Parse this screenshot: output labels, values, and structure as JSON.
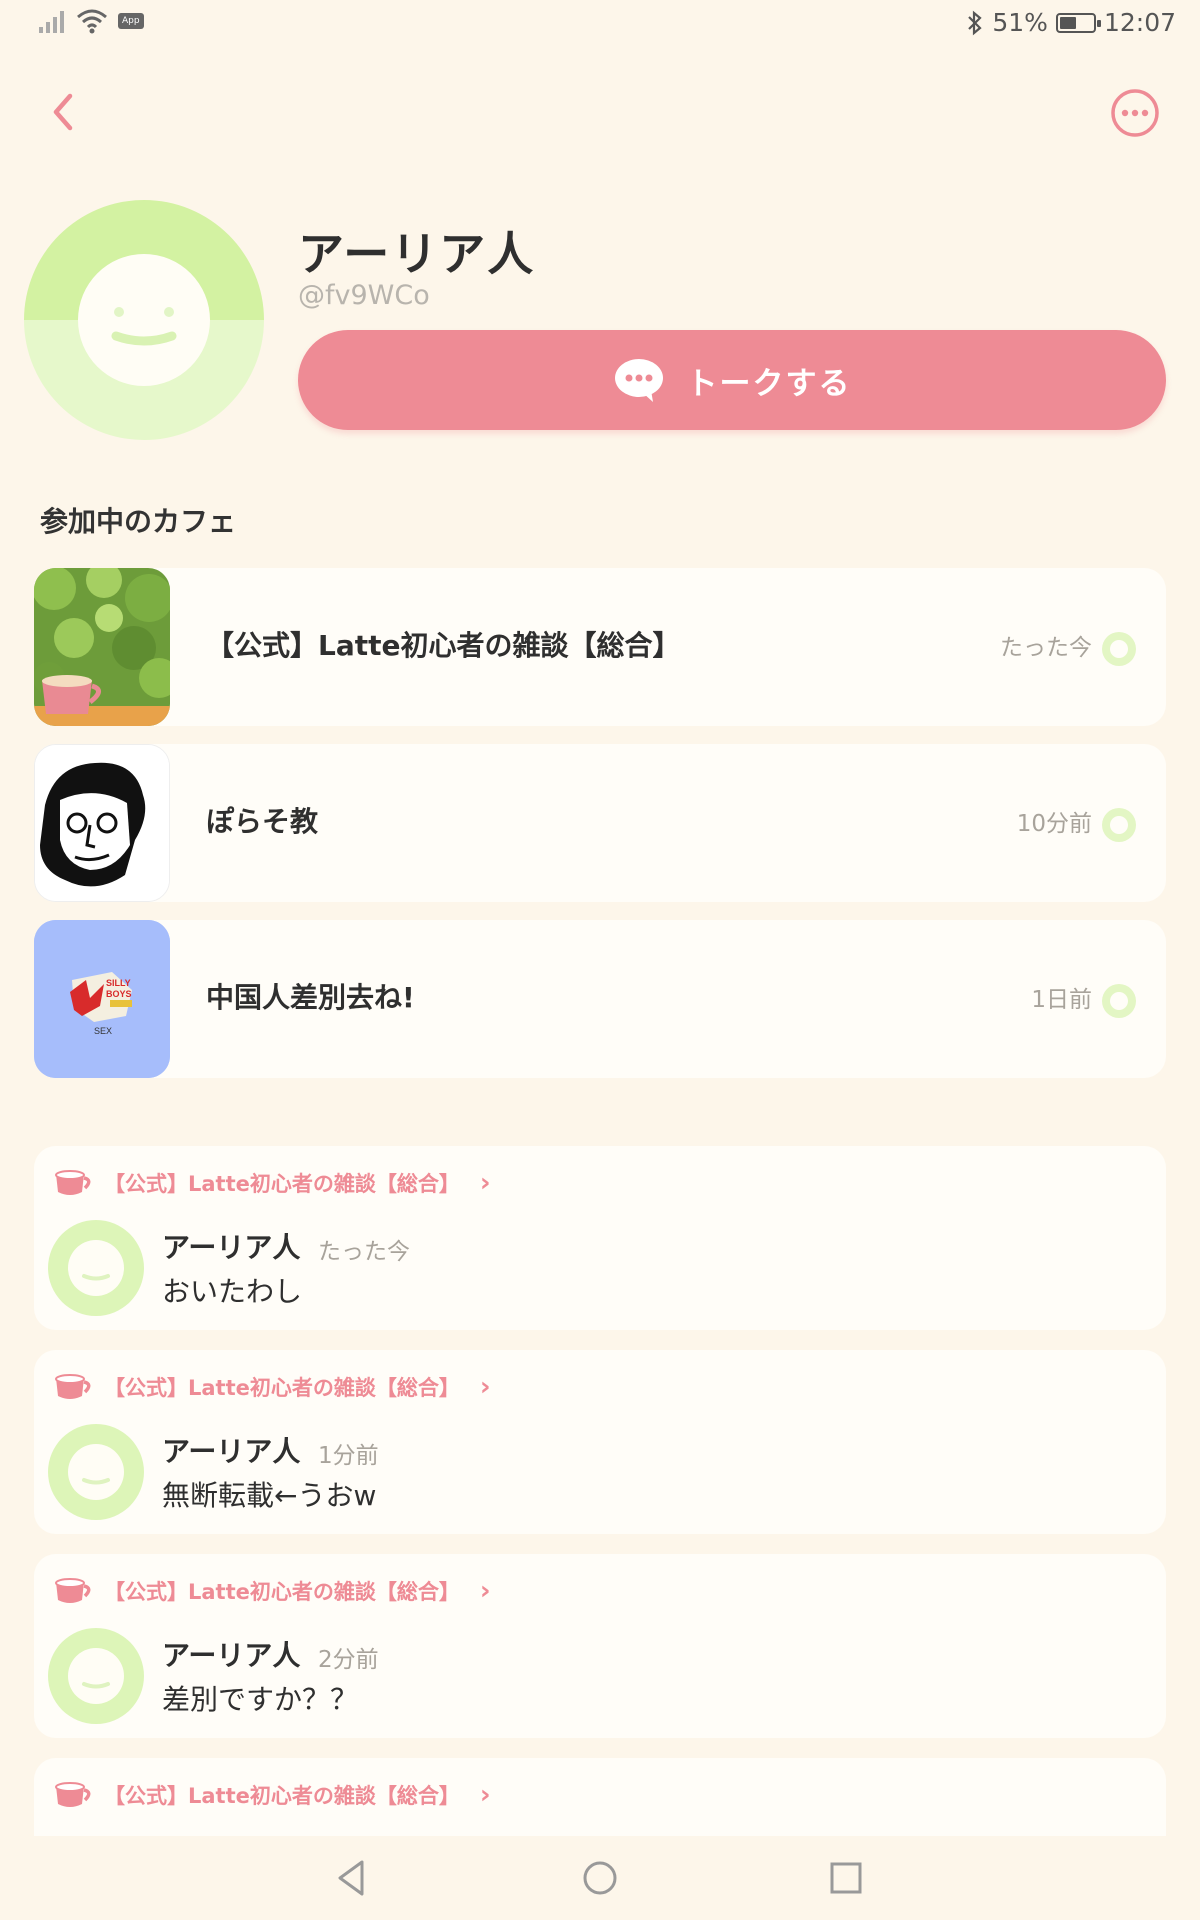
{
  "status_bar": {
    "app_badge": "App",
    "battery_pct": "51%",
    "battery_level": 0.51,
    "time": "12:07"
  },
  "header": {
    "back_icon": "chevron-left-icon",
    "more_icon": "more-dots-icon"
  },
  "profile": {
    "name": "アーリア人",
    "handle": "@fv9WCo",
    "talk_label": "トークする"
  },
  "cafes": {
    "title": "参加中のカフェ",
    "items": [
      {
        "name": "【公式】Latte初心者の雑談【総合】",
        "time": "たった今"
      },
      {
        "name": "ぽらそ教",
        "time": "10分前"
      },
      {
        "name": "中国人差別去ね!",
        "time": "1日前"
      }
    ]
  },
  "posts": [
    {
      "cafe": "【公式】Latte初心者の雑談【総合】",
      "author": "アーリア人",
      "time": "たった今",
      "text": "おいたわし"
    },
    {
      "cafe": "【公式】Latte初心者の雑談【総合】",
      "author": "アーリア人",
      "time": "1分前",
      "text": "無断転載←うおw"
    },
    {
      "cafe": "【公式】Latte初心者の雑談【総合】",
      "author": "アーリア人",
      "time": "2分前",
      "text": "差別ですか？？"
    },
    {
      "cafe": "【公式】Latte初心者の雑談【総合】"
    }
  ],
  "colors": {
    "accent": "#ee8b95",
    "background": "#fdf6ea",
    "card": "#fffdf8",
    "avatar_green": "#d9f5b0"
  }
}
